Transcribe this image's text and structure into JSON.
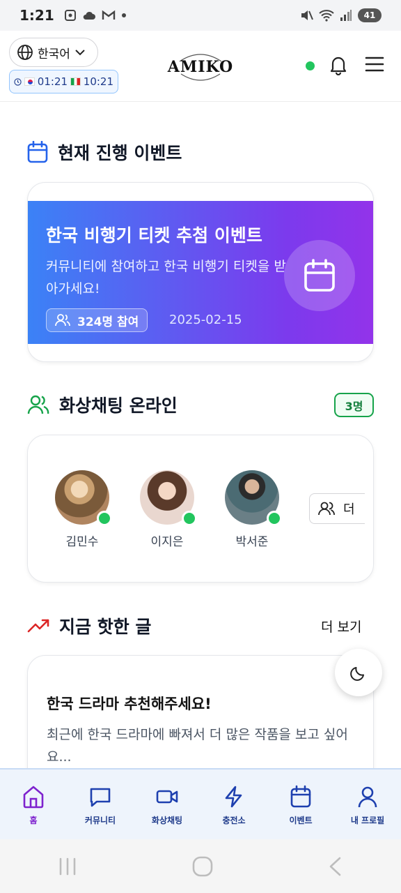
{
  "status_bar": {
    "time": "1:21",
    "battery": "41"
  },
  "header": {
    "language": "한국어",
    "time_korea": "01:21",
    "time_mexico": "10:21",
    "logo": "AMIKO"
  },
  "events": {
    "section_title": "현재 진행 이벤트",
    "card": {
      "title": "한국 비행기 티켓 추첨 이벤트",
      "description": "커뮤니티에 참여하고 한국 비행기 티켓을 받아가세요!",
      "participants": "324명 참여",
      "date": "2025-02-15"
    }
  },
  "video_chat": {
    "section_title": "화상채팅 온라인",
    "count_badge": "3명",
    "users": [
      {
        "name": "김민수"
      },
      {
        "name": "이지은"
      },
      {
        "name": "박서준"
      }
    ],
    "more_label": "더"
  },
  "hot_posts": {
    "section_title": "지금 핫한 글",
    "more_label": "더 보기",
    "post": {
      "title": "한국 드라마 추천해주세요!",
      "body": "최근에 한국 드라마에 빠져서 더 많은 작품을 보고 싶어요..."
    }
  },
  "bottom_nav": {
    "items": [
      {
        "label": "홈",
        "icon": "home-icon",
        "active": true
      },
      {
        "label": "커뮤니티",
        "icon": "chat-bubble-icon"
      },
      {
        "label": "화상채팅",
        "icon": "video-icon"
      },
      {
        "label": "충전소",
        "icon": "lightning-icon"
      },
      {
        "label": "이벤트",
        "icon": "calendar-icon"
      },
      {
        "label": "내 프로필",
        "icon": "user-icon"
      }
    ]
  },
  "colors": {
    "accent_purple": "#7e22ce",
    "nav_blue": "#1e3a8a",
    "online_green": "#22c55e",
    "banner_start": "#3b82f6",
    "banner_end": "#9333ea"
  }
}
